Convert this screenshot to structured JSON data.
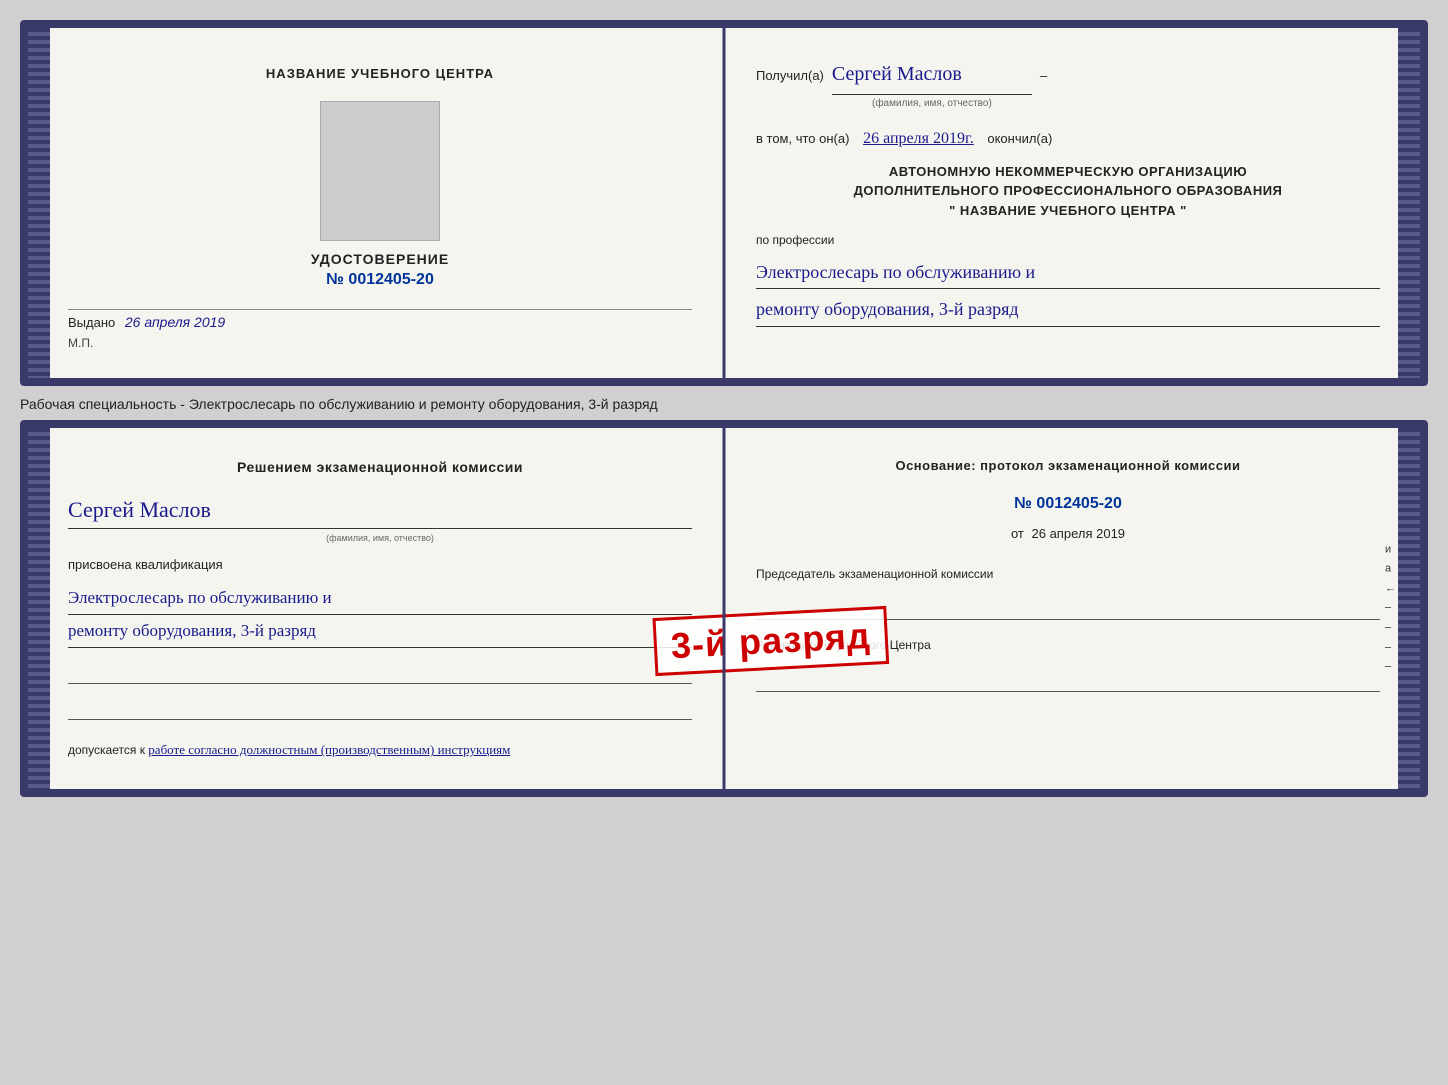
{
  "top_doc": {
    "left": {
      "center_title": "НАЗВАНИЕ УЧЕБНОГО ЦЕНТРА",
      "udostoverenie_label": "УДОСТОВЕРЕНИЕ",
      "number": "№ 0012405-20",
      "vydano_label": "Выдано",
      "vydano_date": "26 апреля 2019",
      "mp_label": "М.П."
    },
    "right": {
      "poluchil_label": "Получил(а)",
      "recipient_name": "Сергей Маслов",
      "fio_subtitle": "(фамилия, имя, отчество)",
      "vtom_label": "в том, что он(а)",
      "date_value": "26 апреля 2019г.",
      "okonchil_label": "окончил(а)",
      "org_line1": "АВТОНОМНУЮ НЕКОММЕРЧЕСКУЮ ОРГАНИЗАЦИЮ",
      "org_line2": "ДОПОЛНИТЕЛЬНОГО ПРОФЕССИОНАЛЬНОГО ОБРАЗОВАНИЯ",
      "org_line3": "\"  НАЗВАНИЕ УЧЕБНОГО ЦЕНТРА  \"",
      "po_professii_label": "по профессии",
      "profession_line1": "Электрослесарь по обслуживанию и",
      "profession_line2": "ремонту оборудования, 3-й разряд"
    }
  },
  "between_text": "Рабочая специальность - Электрослесарь по обслуживанию и ремонту оборудования, 3-й разряд",
  "bottom_doc": {
    "left": {
      "commission_title": "Решением экзаменационной  комиссии",
      "name": "Сергей Маслов",
      "fio_subtitle": "(фамилия, имя, отчество)",
      "prisvoena_label": "присвоена квалификация",
      "profession_line1": "Электрослесарь по обслуживанию и",
      "profession_line2": "ремонту оборудования, 3-й разряд",
      "dopuskaetsya_label": "допускается к",
      "dopuskaetsya_value": "работе согласно должностным (производственным) инструкциям"
    },
    "right": {
      "osnovaniye_title": "Основание: протокол экзаменационной  комиссии",
      "number": "№  0012405-20",
      "ot_label": "от",
      "ot_date": "26 апреля 2019",
      "chairman_label": "Председатель экзаменационной комиссии",
      "rukovoditel_label": "Руководитель учебного Центра"
    },
    "stamp": {
      "line1": "3-й разряд"
    }
  },
  "side_letters": [
    "и",
    "а",
    "←",
    "–",
    "–",
    "–",
    "–"
  ]
}
